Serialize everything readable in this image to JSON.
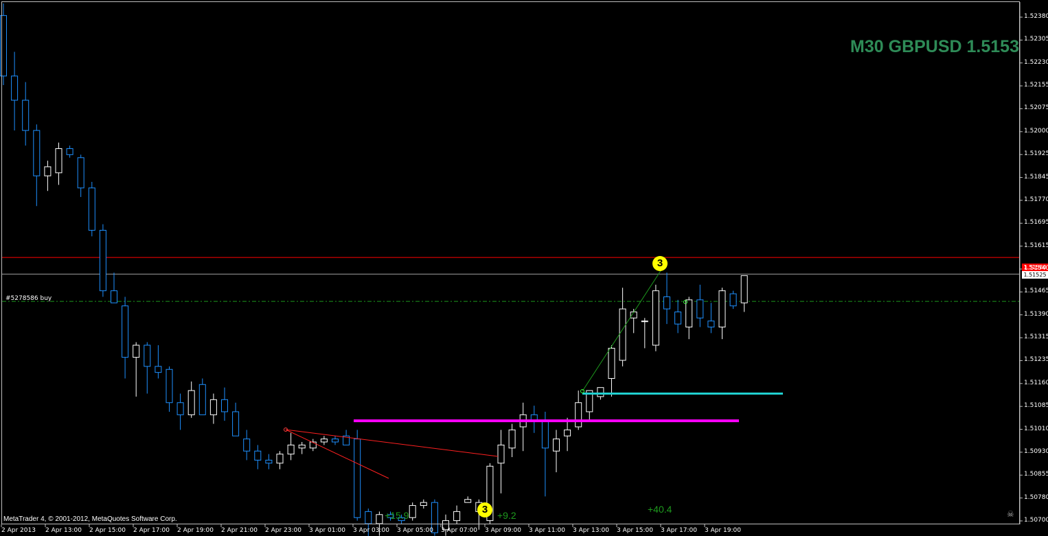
{
  "header": {
    "title": "M30 GBPUSD 1.5153",
    "color": "#2e8b57"
  },
  "copyright": "MetaTrader 4, © 2001-2012, MetaQuotes Software Corp.",
  "order_label": "#5278586 buy",
  "price_tags": {
    "red": "1.51580",
    "gray": "1.51525"
  },
  "price_axis": [
    "1.52380",
    "1.52305",
    "1.52230",
    "1.52155",
    "1.52075",
    "1.52000",
    "1.51925",
    "1.51845",
    "1.51770",
    "1.51695",
    "1.51615",
    "1.51540",
    "1.51465",
    "1.51390",
    "1.51315",
    "1.51235",
    "1.51160",
    "1.51085",
    "1.51010",
    "1.50930",
    "1.50855",
    "1.50780",
    "1.50700"
  ],
  "time_axis": [
    "2 Apr 2013",
    "2 Apr 13:00",
    "2 Apr 15:00",
    "2 Apr 17:00",
    "2 Apr 19:00",
    "2 Apr 21:00",
    "2 Apr 23:00",
    "3 Apr 01:00",
    "3 Apr 03:00",
    "3 Apr 05:00",
    "3 Apr 07:00",
    "3 Apr 09:00",
    "3 Apr 11:00",
    "3 Apr 13:00",
    "3 Apr 15:00",
    "3 Apr 17:00",
    "3 Apr 19:00"
  ],
  "profit_labels": [
    "+15.9",
    "+9.2",
    "+40.4"
  ],
  "badges": [
    "3",
    "3"
  ],
  "colors": {
    "bull": "#ffffff",
    "bear": "#1e90ff",
    "resistance": "#ff0000",
    "bid": "#a0a0a0",
    "magenta": "#ff00ff",
    "cyan": "#20d0d0",
    "entry": "#1e9a1e",
    "profit": "#1e9a1e"
  },
  "icons": [
    "skull-icon"
  ],
  "chart_data": {
    "type": "candlestick",
    "title": "M30 GBPUSD 1.5153",
    "ylim": [
      1.507,
      1.5242
    ],
    "lines": {
      "resistance": 1.5158,
      "bid": 1.51525,
      "order_entry": 1.51435,
      "magenta_level": 1.5104,
      "cyan_level": 1.5113
    },
    "candles": [
      [
        1.5238,
        1.5242,
        1.5215,
        1.5218
      ],
      [
        1.5218,
        1.5226,
        1.52,
        1.521
      ],
      [
        1.521,
        1.5216,
        1.5195,
        1.52
      ],
      [
        1.52,
        1.5202,
        1.5175,
        1.5185
      ],
      [
        1.5185,
        1.519,
        1.518,
        1.5188
      ],
      [
        1.5186,
        1.5196,
        1.5182,
        1.5194
      ],
      [
        1.5194,
        1.5195,
        1.5191,
        1.5192
      ],
      [
        1.5191,
        1.5192,
        1.5178,
        1.5181
      ],
      [
        1.5181,
        1.5183,
        1.5165,
        1.5167
      ],
      [
        1.5167,
        1.5169,
        1.5145,
        1.5147
      ],
      [
        1.5147,
        1.5153,
        1.5143,
        1.5143
      ],
      [
        1.5142,
        1.5145,
        1.5118,
        1.5125
      ],
      [
        1.5125,
        1.513,
        1.5112,
        1.5129
      ],
      [
        1.5129,
        1.513,
        1.5113,
        1.5122
      ],
      [
        1.5122,
        1.5129,
        1.5118,
        1.512
      ],
      [
        1.5121,
        1.5122,
        1.5107,
        1.511
      ],
      [
        1.511,
        1.5113,
        1.5101,
        1.5106
      ],
      [
        1.5106,
        1.5117,
        1.5105,
        1.5114
      ],
      [
        1.5116,
        1.5118,
        1.5106,
        1.5106
      ],
      [
        1.5106,
        1.5113,
        1.5103,
        1.5111
      ],
      [
        1.5111,
        1.5115,
        1.5104,
        1.5107
      ],
      [
        1.5107,
        1.511,
        1.5099,
        1.5099
      ],
      [
        1.5098,
        1.5101,
        1.5091,
        1.5094
      ],
      [
        1.5094,
        1.5096,
        1.5088,
        1.5091
      ],
      [
        1.5091,
        1.5093,
        1.5088,
        1.509
      ],
      [
        1.509,
        1.5094,
        1.5088,
        1.5093
      ],
      [
        1.5093,
        1.51,
        1.5091,
        1.5096
      ],
      [
        1.5095,
        1.5097,
        1.5093,
        1.5096
      ],
      [
        1.5095,
        1.5098,
        1.5094,
        1.5097
      ],
      [
        1.5097,
        1.5099,
        1.5096,
        1.5098
      ],
      [
        1.5098,
        1.5099,
        1.5096,
        1.5097
      ],
      [
        1.5099,
        1.5101,
        1.5096,
        1.5096
      ],
      [
        1.5098,
        1.5101,
        1.5071,
        1.5072
      ],
      [
        1.5074,
        1.5075,
        1.5065,
        1.507
      ],
      [
        1.507,
        1.5074,
        1.5066,
        1.5073
      ],
      [
        1.5073,
        1.5074,
        1.5071,
        1.5072
      ],
      [
        1.5072,
        1.5073,
        1.507,
        1.5071
      ],
      [
        1.5072,
        1.5077,
        1.5071,
        1.5076
      ],
      [
        1.5076,
        1.5078,
        1.5075,
        1.5077
      ],
      [
        1.5077,
        1.5078,
        1.5066,
        1.5067
      ],
      [
        1.5068,
        1.5073,
        1.5066,
        1.5071
      ],
      [
        1.5071,
        1.5076,
        1.507,
        1.5074
      ],
      [
        1.5077,
        1.5079,
        1.5077,
        1.5078
      ],
      [
        1.5074,
        1.5078,
        1.5068,
        1.5077
      ],
      [
        1.5071,
        1.509,
        1.507,
        1.5089
      ],
      [
        1.509,
        1.5101,
        1.508,
        1.5096
      ],
      [
        1.5095,
        1.5103,
        1.5092,
        1.5101
      ],
      [
        1.5102,
        1.511,
        1.5094,
        1.5106
      ],
      [
        1.5106,
        1.5109,
        1.51,
        1.5104
      ],
      [
        1.5104,
        1.5107,
        1.5079,
        1.5095
      ],
      [
        1.5094,
        1.5101,
        1.5087,
        1.5098
      ],
      [
        1.5099,
        1.5105,
        1.5094,
        1.5101
      ],
      [
        1.5102,
        1.5114,
        1.5101,
        1.511
      ],
      [
        1.5107,
        1.5113,
        1.5104,
        1.5114
      ],
      [
        1.5112,
        1.5115,
        1.5111,
        1.5115
      ],
      [
        1.5118,
        1.5129,
        1.5112,
        1.5128
      ],
      [
        1.5124,
        1.5148,
        1.5122,
        1.5141
      ],
      [
        1.5138,
        1.5141,
        1.5133,
        1.514
      ],
      [
        1.5137,
        1.5138,
        1.5128,
        1.5137
      ],
      [
        1.5129,
        1.5149,
        1.5127,
        1.5147
      ],
      [
        1.5145,
        1.5153,
        1.5136,
        1.5141
      ],
      [
        1.514,
        1.5144,
        1.5133,
        1.5136
      ],
      [
        1.5135,
        1.5145,
        1.5131,
        1.5144
      ],
      [
        1.5144,
        1.5149,
        1.5135,
        1.5138
      ],
      [
        1.5137,
        1.5143,
        1.5133,
        1.5135
      ],
      [
        1.5135,
        1.5148,
        1.5131,
        1.5147
      ],
      [
        1.5146,
        1.5147,
        1.5141,
        1.5142
      ],
      [
        1.5143,
        1.5151,
        1.514,
        1.5152
      ]
    ]
  }
}
